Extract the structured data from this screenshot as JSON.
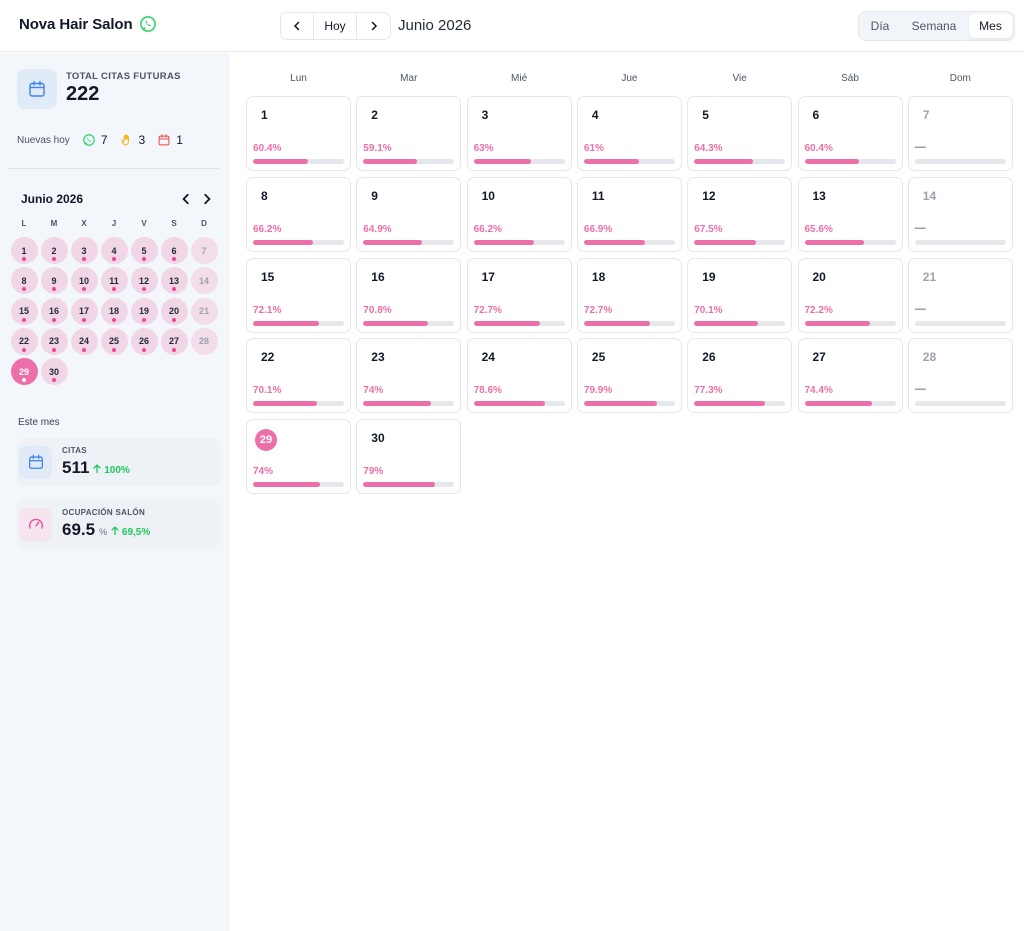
{
  "header": {
    "brand": "Nova Hair Salon",
    "today_label": "Hoy",
    "prev_icon": "chevron-left-icon",
    "next_icon": "chevron-right-icon",
    "month_title": "Junio 2026",
    "views": [
      "Día",
      "Semana",
      "Mes"
    ],
    "active_view": "Mes"
  },
  "sidebar": {
    "total_label": "TOTAL CITAS FUTURAS",
    "total_value": "222",
    "new_today_label": "Nuevas hoy",
    "new_today": [
      {
        "icon": "whatsapp-icon",
        "count": "7"
      },
      {
        "icon": "hand-icon",
        "count": "3"
      },
      {
        "icon": "calendar-icon",
        "count": "1"
      }
    ],
    "mini_title": "Junio 2026",
    "mini_dow": [
      "L",
      "M",
      "X",
      "J",
      "V",
      "S",
      "D"
    ],
    "this_month_label": "Este mes",
    "citas_label": "CITAS",
    "citas_value": "511",
    "citas_delta": "100%",
    "occupancy_label": "OCUPACIÓN SALÓN",
    "occupancy_value": "69.5",
    "occupancy_unit": "%",
    "occupancy_delta": "69,5%"
  },
  "calendar": {
    "dow": [
      "Lun",
      "Mar",
      "Mié",
      "Jue",
      "Vie",
      "Sáb",
      "Dom"
    ],
    "today": 29,
    "days": [
      {
        "day": "1",
        "pct": "60.4%",
        "value": 60.4
      },
      {
        "day": "2",
        "pct": "59.1%",
        "value": 59.1
      },
      {
        "day": "3",
        "pct": "63%",
        "value": 63
      },
      {
        "day": "4",
        "pct": "61%",
        "value": 61
      },
      {
        "day": "5",
        "pct": "64.3%",
        "value": 64.3
      },
      {
        "day": "6",
        "pct": "60.4%",
        "value": 60.4
      },
      {
        "day": "7",
        "pct": "—",
        "value": 0
      },
      {
        "day": "8",
        "pct": "66.2%",
        "value": 66.2
      },
      {
        "day": "9",
        "pct": "64.9%",
        "value": 64.9
      },
      {
        "day": "10",
        "pct": "66.2%",
        "value": 66.2
      },
      {
        "day": "11",
        "pct": "66.9%",
        "value": 66.9
      },
      {
        "day": "12",
        "pct": "67.5%",
        "value": 67.5
      },
      {
        "day": "13",
        "pct": "65.6%",
        "value": 65.6
      },
      {
        "day": "14",
        "pct": "—",
        "value": 0
      },
      {
        "day": "15",
        "pct": "72.1%",
        "value": 72.1
      },
      {
        "day": "16",
        "pct": "70.8%",
        "value": 70.8
      },
      {
        "day": "17",
        "pct": "72.7%",
        "value": 72.7
      },
      {
        "day": "18",
        "pct": "72.7%",
        "value": 72.7
      },
      {
        "day": "19",
        "pct": "70.1%",
        "value": 70.1
      },
      {
        "day": "20",
        "pct": "72.2%",
        "value": 72.2
      },
      {
        "day": "21",
        "pct": "—",
        "value": 0
      },
      {
        "day": "22",
        "pct": "70.1%",
        "value": 70.1
      },
      {
        "day": "23",
        "pct": "74%",
        "value": 74
      },
      {
        "day": "24",
        "pct": "78.6%",
        "value": 78.6
      },
      {
        "day": "25",
        "pct": "79.9%",
        "value": 79.9
      },
      {
        "day": "26",
        "pct": "77.3%",
        "value": 77.3
      },
      {
        "day": "27",
        "pct": "74.4%",
        "value": 74.4
      },
      {
        "day": "28",
        "pct": "—",
        "value": 0
      },
      {
        "day": "29",
        "pct": "74%",
        "value": 74
      },
      {
        "day": "30",
        "pct": "79%",
        "value": 79
      }
    ]
  },
  "colors": {
    "accent": "#ec6fa9",
    "success": "#22c55e",
    "whatsapp": "#25d366"
  }
}
